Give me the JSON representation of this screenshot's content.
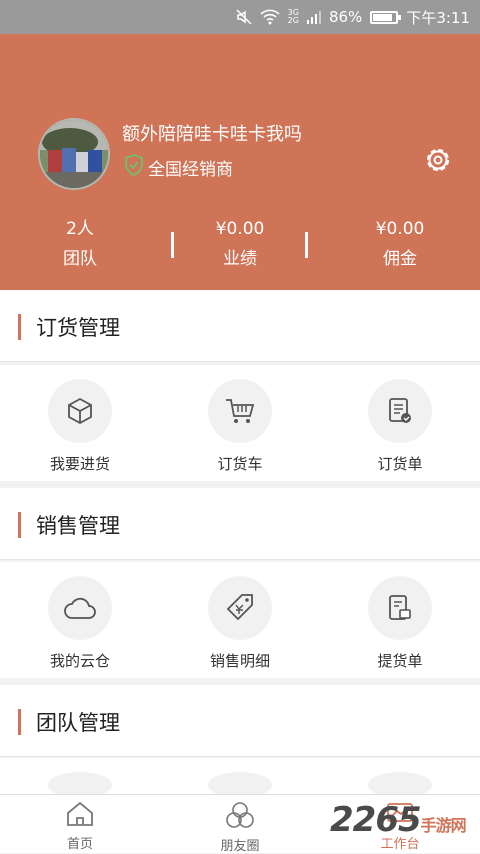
{
  "status_bar": {
    "battery": "86%",
    "time": "下午3:11",
    "net_top": "3G",
    "net_bottom": "2G",
    "battery_level": 0.86
  },
  "profile": {
    "username": "额外陪陪哇卡哇卡我吗",
    "badge": "全国经销商"
  },
  "stats": [
    {
      "value": "2人",
      "label": "团队"
    },
    {
      "value": "¥0.00",
      "label": "业绩"
    },
    {
      "value": "¥0.00",
      "label": "佣金"
    }
  ],
  "sections": {
    "order": {
      "title": "订货管理",
      "items": [
        {
          "label": "我要进货",
          "icon": "box-icon"
        },
        {
          "label": "订货车",
          "icon": "cart-icon"
        },
        {
          "label": "订货单",
          "icon": "order-list-icon"
        }
      ]
    },
    "sales": {
      "title": "销售管理",
      "items": [
        {
          "label": "我的云仓",
          "icon": "cloud-icon"
        },
        {
          "label": "销售明细",
          "icon": "price-tag-icon"
        },
        {
          "label": "提货单",
          "icon": "pickup-list-icon"
        }
      ]
    },
    "team": {
      "title": "团队管理"
    }
  },
  "tabbar": [
    {
      "label": "首页",
      "icon": "home-icon"
    },
    {
      "label": "朋友圈",
      "icon": "moments-icon"
    },
    {
      "label": "工作台",
      "icon": "workbench-icon"
    }
  ],
  "watermark": {
    "main": "2265",
    "sub": "手游网"
  },
  "colors": {
    "accent": "#d07458",
    "status_bar": "#9a9a9a",
    "badge_green": "#4caf50"
  }
}
